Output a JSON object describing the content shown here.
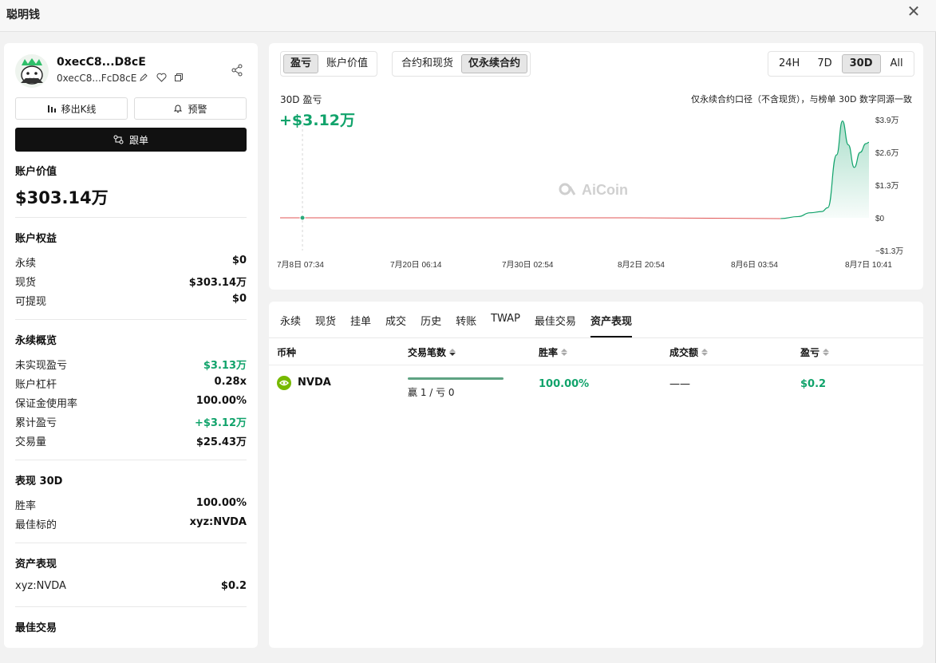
{
  "window": {
    "title": "聪明钱",
    "close": "✕"
  },
  "profile": {
    "address_short": "0xecC8...D8cE",
    "address_sub": "0xecC8...FcD8cE",
    "btn_kline": "移出K线",
    "btn_alert": "预警",
    "btn_follow": "跟单"
  },
  "account": {
    "value_title": "账户价值",
    "value": "$303.14万",
    "equity_title": "账户权益",
    "equity": [
      {
        "k": "永续",
        "v": "$0"
      },
      {
        "k": "现货",
        "v": "$303.14万"
      },
      {
        "k": "可提现",
        "v": "$0"
      }
    ],
    "perp_title": "永续概览",
    "perp": [
      {
        "k": "未实现盈亏",
        "v": "$3.13万"
      },
      {
        "k": "账户杠杆",
        "v": "0.28x"
      },
      {
        "k": "保证金使用率",
        "v": "100.00%"
      },
      {
        "k": "累计盈亏",
        "v": "+$3.12万"
      },
      {
        "k": "交易量",
        "v": "$25.43万"
      }
    ],
    "perf_title": "表现 30D",
    "perf": [
      {
        "k": "胜率",
        "v": "100.00%"
      },
      {
        "k": "最佳标的",
        "v": "xyz:NVDA"
      }
    ],
    "asset_title": "资产表现",
    "asset": [
      {
        "k": "xyz:NVDA",
        "v": "$0.2"
      }
    ],
    "best_title": "最佳交易"
  },
  "chart_panel": {
    "seg1": [
      "盈亏",
      "账户价值"
    ],
    "seg2": [
      "合约和现货",
      "仅永续合约"
    ],
    "seg3": [
      "24H",
      "7D",
      "30D",
      "All"
    ],
    "label": "30D 盈亏",
    "value": "+$3.12万",
    "note": "仅永续合约口径（不含现货），与榜单 30D 数字同源一致",
    "watermark": "AiCoin"
  },
  "chart_data": {
    "type": "area",
    "y_ticks": [
      "$3.9万",
      "$2.6万",
      "$1.3万",
      "$0",
      "−$1.3万"
    ],
    "y_tick_values": [
      3.9,
      2.6,
      1.3,
      0,
      -1.3
    ],
    "x_ticks": [
      "7月8日 07:34",
      "7月20日 06:14",
      "7月30日 02:54",
      "8月2日 20:54",
      "8月6日 03:54",
      "8月7日 10:41"
    ],
    "ylim": [
      -1.3,
      3.9
    ],
    "unit": "万",
    "series": [
      {
        "points": [
          [
            0,
            0
          ],
          [
            0.2,
            0
          ],
          [
            0.4,
            0
          ],
          [
            0.6,
            0
          ],
          [
            0.85,
            -0.03
          ],
          [
            0.88,
            0.05
          ],
          [
            0.9,
            0.2
          ],
          [
            0.92,
            0.25
          ],
          [
            0.93,
            0.4
          ],
          [
            0.945,
            2.5
          ],
          [
            0.955,
            3.85
          ],
          [
            0.965,
            2.9
          ],
          [
            0.975,
            2.0
          ],
          [
            0.985,
            2.6
          ],
          [
            0.995,
            2.95
          ],
          [
            1.0,
            3.0
          ]
        ]
      }
    ]
  },
  "table": {
    "tabs": [
      "永续",
      "现货",
      "挂单",
      "成交",
      "历史",
      "转账",
      "TWAP",
      "最佳交易",
      "资产表现"
    ],
    "active_tab": 8,
    "headers": [
      "币种",
      "交易笔数",
      "胜率",
      "成交额",
      "盈亏"
    ],
    "rows": [
      {
        "coin": "NVDA",
        "trades": "赢 1 / 亏 0",
        "win_rate": "100.00%",
        "volume": "——",
        "pnl": "$0.2"
      }
    ]
  },
  "colors": {
    "green": "#11a36b",
    "red": "#e05555",
    "accent": "#111111"
  }
}
